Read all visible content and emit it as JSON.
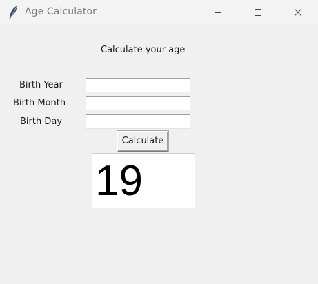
{
  "window": {
    "title": "Age Calculator",
    "icon": "feather-icon",
    "controls": [
      "minimize-icon",
      "maximize-icon",
      "close-icon"
    ]
  },
  "form": {
    "heading": "Calculate your age",
    "fields": [
      {
        "label": "Birth Year",
        "value": "",
        "placeholder": ""
      },
      {
        "label": "Birth Month",
        "value": "",
        "placeholder": ""
      },
      {
        "label": "Birth Day",
        "value": "",
        "placeholder": ""
      }
    ],
    "button_label": "Calculate",
    "result": "19"
  }
}
